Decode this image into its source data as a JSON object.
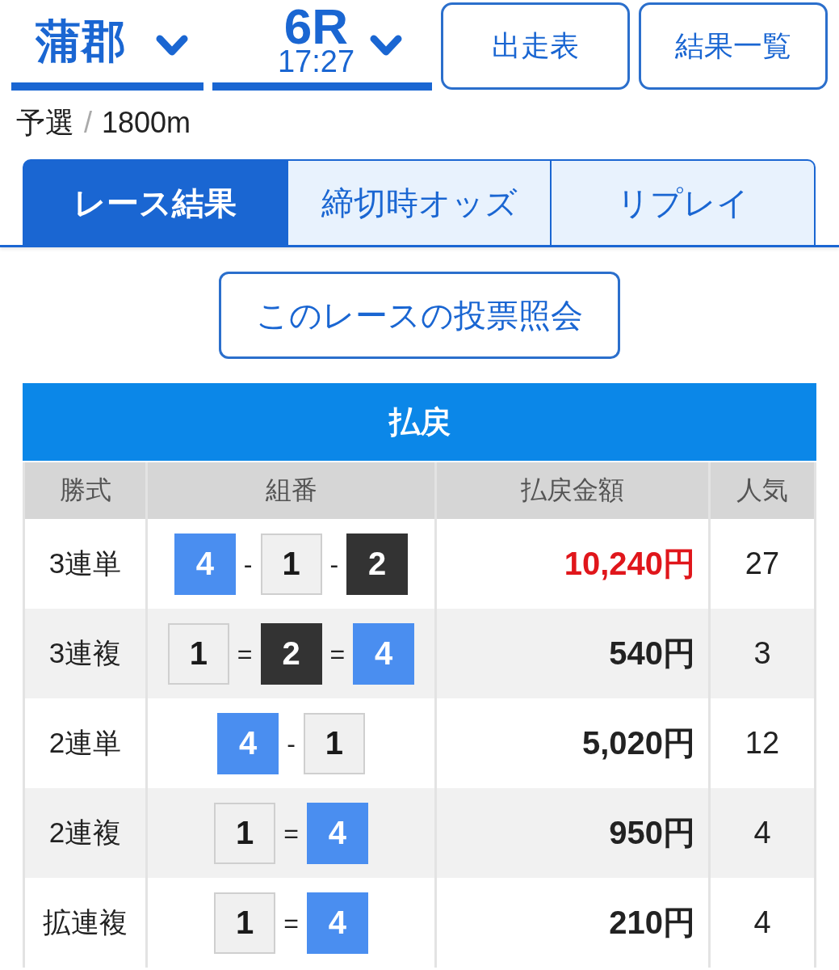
{
  "venue_selector": {
    "venue": "蒲郡"
  },
  "race_selector": {
    "race": "6R",
    "start_time": "17:27"
  },
  "nav_buttons": [
    "出走表",
    "結果一覧"
  ],
  "race_info": {
    "class": "予選",
    "separator": "/",
    "distance": "1800m"
  },
  "tabs": [
    {
      "label": "レース結果",
      "selected": true
    },
    {
      "label": "締切時オッズ",
      "selected": false
    },
    {
      "label": "リプレイ",
      "selected": false
    }
  ],
  "vote_inquiry_button": {
    "label": "このレースの投票照会"
  },
  "payout_table": {
    "title": "払戻",
    "columns": [
      "勝式",
      "組番",
      "払戻金額",
      "人気"
    ],
    "rows": [
      {
        "bet_type": "3連単",
        "combination": [
          {
            "kind": "boat",
            "number": "4",
            "color": "#4a8ef0"
          },
          {
            "kind": "separator",
            "text": "-"
          },
          {
            "kind": "boat",
            "number": "1",
            "color": "#f0f0f0"
          },
          {
            "kind": "separator",
            "text": "-"
          },
          {
            "kind": "boat",
            "number": "2",
            "color": "#333333"
          }
        ],
        "amount": "10,240円",
        "highlighted": true,
        "popularity": "27"
      },
      {
        "bet_type": "3連複",
        "combination": [
          {
            "kind": "boat",
            "number": "1",
            "color": "#f0f0f0"
          },
          {
            "kind": "separator",
            "text": "="
          },
          {
            "kind": "boat",
            "number": "2",
            "color": "#333333"
          },
          {
            "kind": "separator",
            "text": "="
          },
          {
            "kind": "boat",
            "number": "4",
            "color": "#4a8ef0"
          }
        ],
        "amount": "540円",
        "highlighted": false,
        "popularity": "3"
      },
      {
        "bet_type": "2連単",
        "combination": [
          {
            "kind": "boat",
            "number": "4",
            "color": "#4a8ef0"
          },
          {
            "kind": "separator",
            "text": "-"
          },
          {
            "kind": "boat",
            "number": "1",
            "color": "#f0f0f0"
          }
        ],
        "amount": "5,020円",
        "highlighted": false,
        "popularity": "12"
      },
      {
        "bet_type": "2連複",
        "combination": [
          {
            "kind": "boat",
            "number": "1",
            "color": "#f0f0f0"
          },
          {
            "kind": "separator",
            "text": "="
          },
          {
            "kind": "boat",
            "number": "4",
            "color": "#4a8ef0"
          }
        ],
        "amount": "950円",
        "highlighted": false,
        "popularity": "4"
      },
      {
        "bet_type": "拡連複",
        "combination": [
          {
            "kind": "boat",
            "number": "1",
            "color": "#f0f0f0"
          },
          {
            "kind": "separator",
            "text": "="
          },
          {
            "kind": "boat",
            "number": "4",
            "color": "#4a8ef0"
          }
        ],
        "amount": "210円",
        "highlighted": false,
        "popularity": "4"
      }
    ]
  }
}
